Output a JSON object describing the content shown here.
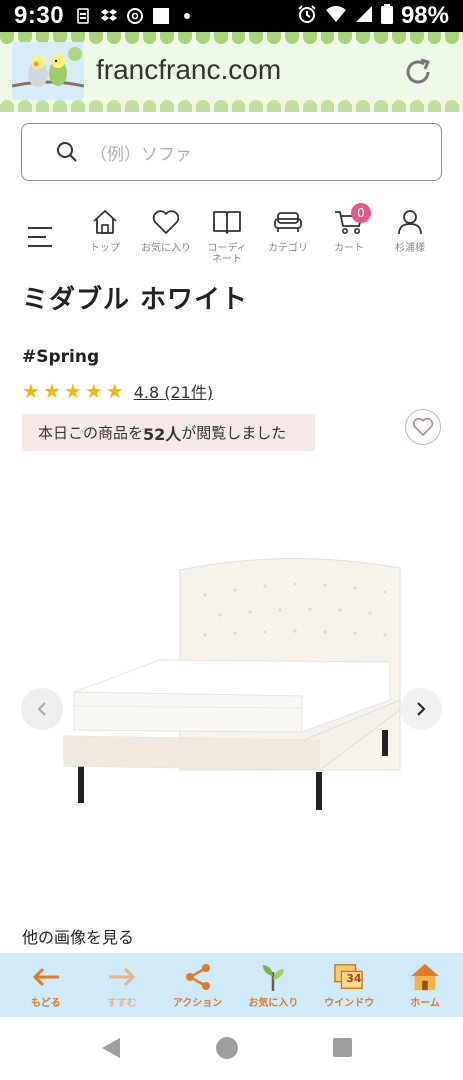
{
  "status_bar": {
    "time": "9:30",
    "battery": "98%"
  },
  "browser": {
    "url": "francfranc.com"
  },
  "search": {
    "placeholder": "（例）ソファ"
  },
  "nav": {
    "items": [
      {
        "label": "トップ",
        "icon": "home-icon"
      },
      {
        "label": "お気に入り",
        "icon": "heart-icon"
      },
      {
        "label": "コーディ\nネート",
        "icon": "book-icon"
      },
      {
        "label": "カテゴリ",
        "icon": "sofa-icon"
      },
      {
        "label": "カート",
        "icon": "cart-icon"
      },
      {
        "label": "杉浦様",
        "icon": "user-icon"
      }
    ],
    "cart_count": "0"
  },
  "product": {
    "title": "ミダブル ホワイト",
    "tag": "#Spring",
    "rating": "4.8",
    "review_count": "(21件)",
    "stars": 5,
    "viewers_prefix": "本日この商品を",
    "viewers_count": "52人",
    "viewers_suffix": "が閲覧しました"
  },
  "gallery": {
    "more_label": "他の画像を見る"
  },
  "toolbar": {
    "items": [
      {
        "label": "もどる",
        "icon": "arrow-left-icon",
        "color": "#e07b2a"
      },
      {
        "label": "すすむ",
        "icon": "arrow-right-icon",
        "color": "#e8b48a"
      },
      {
        "label": "アクション",
        "icon": "share-icon",
        "color": "#e07b2a"
      },
      {
        "label": "お気に入り",
        "icon": "leaf-icon",
        "color": "#e07b2a"
      },
      {
        "label": "ウインドウ",
        "icon": "windows-icon",
        "color": "#e07b2a"
      },
      {
        "label": "ホーム",
        "icon": "house-icon",
        "color": "#e07b2a"
      }
    ],
    "window_count": "34"
  },
  "colors": {
    "accent_pink": "#e8568d",
    "star": "#f5b800",
    "banner_bg": "#f6e8e6",
    "toolbar_bg": "#cfeaf8"
  }
}
